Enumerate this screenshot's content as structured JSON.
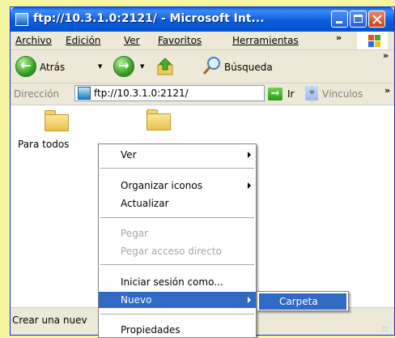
{
  "window": {
    "title": "ftp://10.3.1.0:2121/ - Microsoft Int..."
  },
  "menubar": {
    "items": [
      "Archivo",
      "Edición",
      "Ver",
      "Favoritos",
      "Herramientas"
    ],
    "overflow": "»"
  },
  "toolbar": {
    "back_label": "Atrás",
    "search_label": "Búsqueda",
    "overflow": "»"
  },
  "address": {
    "label": "Dirección",
    "value": "ftp://10.3.1.0:2121/",
    "go_label": "Ir",
    "links_label": "Vínculos",
    "overflow": "»"
  },
  "content": {
    "folders": [
      {
        "label": "Para todos"
      }
    ]
  },
  "status": {
    "text": "Crear una nuev"
  },
  "context_menu": {
    "items": [
      {
        "label": "Ver"
      },
      {
        "label": "Organizar iconos"
      },
      {
        "label": "Actualizar"
      },
      {
        "label": "Pegar"
      },
      {
        "label": "Pegar acceso directo"
      },
      {
        "label": "Iniciar sesión como..."
      },
      {
        "label": "Nuevo"
      },
      {
        "label": "Propiedades"
      }
    ],
    "submenu": {
      "items": [
        {
          "label": "Carpeta"
        }
      ]
    }
  },
  "colors": {
    "selection": "#316ac5",
    "titlebar": "#0b5bdc",
    "background": "#f6f5a2"
  }
}
